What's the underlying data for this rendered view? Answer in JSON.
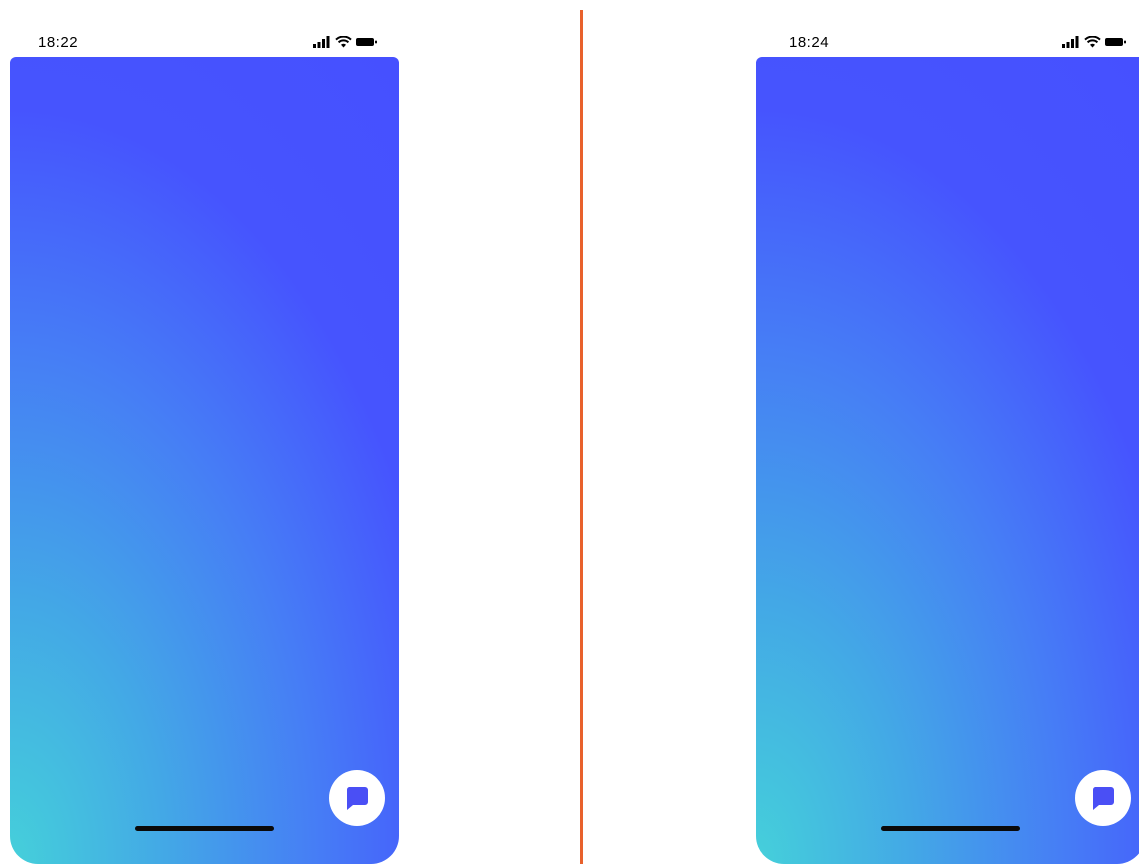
{
  "colors": {
    "divider": "#e8612c",
    "gradient_top": "#4650ff",
    "gradient_bottom": "#45d0da",
    "chat_icon": "#4a4ff5"
  },
  "screens": [
    {
      "status_bar": {
        "time": "18:22",
        "icons": [
          "signal-icon",
          "wifi-icon",
          "battery-icon"
        ]
      },
      "chat_button": {
        "icon": "chat-bubble-icon"
      }
    },
    {
      "status_bar": {
        "time": "18:24",
        "icons": [
          "signal-icon",
          "wifi-icon",
          "battery-icon"
        ]
      },
      "chat_button": {
        "icon": "chat-bubble-icon"
      }
    }
  ]
}
